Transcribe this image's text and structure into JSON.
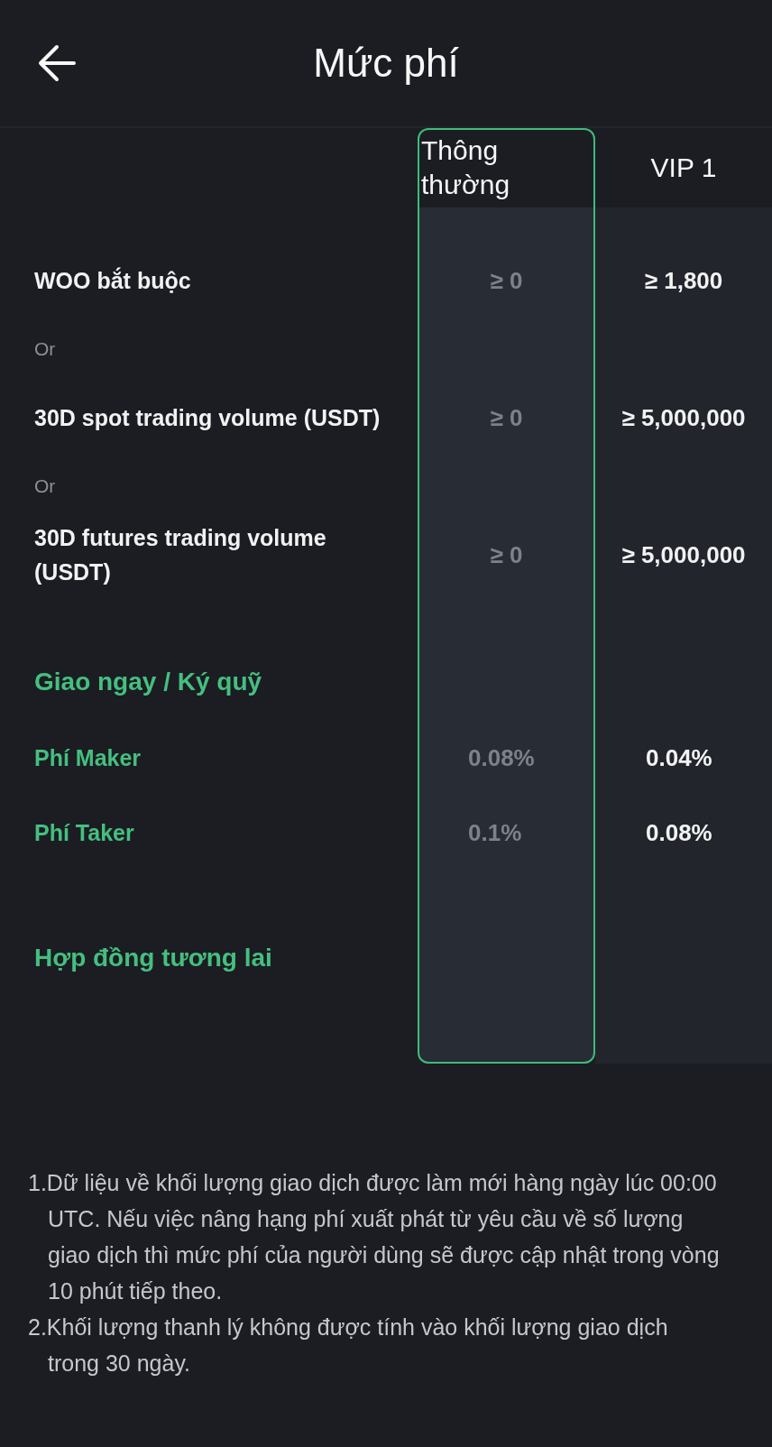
{
  "header": {
    "title": "Mức phí"
  },
  "table": {
    "columns": [
      {
        "label": "Thông thường",
        "selected": true
      },
      {
        "label": "VIP 1",
        "selected": false
      }
    ],
    "rows": [
      {
        "kind": "requirement",
        "label": "WOO bắt buộc",
        "values": [
          "≥ 0",
          "≥ 1,800"
        ]
      },
      {
        "kind": "separator",
        "label": "Or"
      },
      {
        "kind": "requirement",
        "label": "30D spot trading volume (USDT)",
        "values": [
          "≥ 0",
          "≥ 5,000,000"
        ]
      },
      {
        "kind": "separator",
        "label": "Or"
      },
      {
        "kind": "requirement",
        "label": "30D futures trading volume (USDT)",
        "values": [
          "≥ 0",
          "≥ 5,000,000"
        ]
      },
      {
        "kind": "section",
        "label": "Giao ngay / Ký quỹ"
      },
      {
        "kind": "fee",
        "label": "Phí Maker",
        "values": [
          "0.08%",
          "0.04%"
        ]
      },
      {
        "kind": "fee",
        "label": "Phí Taker",
        "values": [
          "0.1%",
          "0.08%"
        ]
      },
      {
        "kind": "section",
        "label": "Hợp đồng tương lai"
      }
    ]
  },
  "notes": [
    "1.Dữ liệu về khối lượng giao dịch được làm mới hàng ngày lúc 00:00 UTC. Nếu việc nâng hạng phí xuất phát từ yêu cầu về số lượng giao dịch thì mức phí của người dùng sẽ được cập nhật trong vòng 10 phút tiếp theo.",
    "2.Khối lượng thanh lý không được tính vào khối lượng giao dịch trong 30 ngày."
  ]
}
